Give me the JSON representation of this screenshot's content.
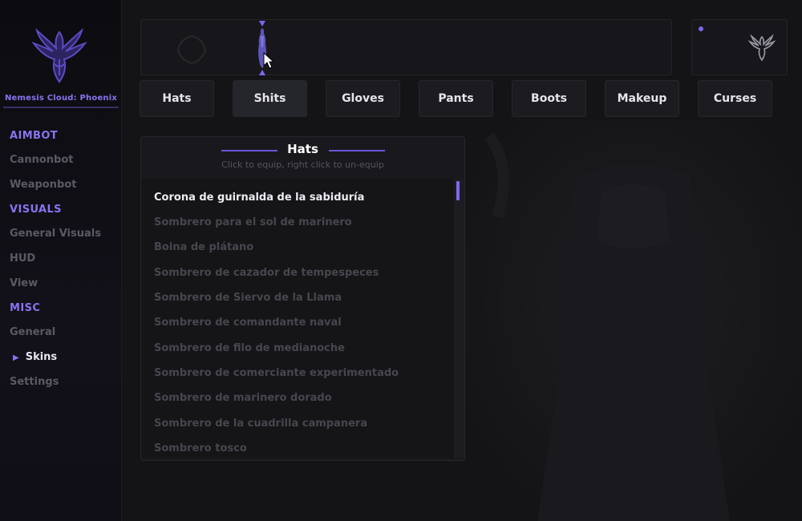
{
  "brand": {
    "name": "Nemesis Cloud: Phoenix",
    "logo_icon": "phoenix-icon"
  },
  "accent": "#7b68ee",
  "sidebar": {
    "sections": [
      {
        "category": "AIMBOT",
        "items": [
          "Cannonbot",
          "Weaponbot"
        ]
      },
      {
        "category": "VISUALS",
        "items": [
          "General Visuals",
          "HUD",
          "View"
        ]
      },
      {
        "category": "MISC",
        "items": [
          "General",
          "Skins",
          "Settings"
        ]
      }
    ],
    "active": "Skins"
  },
  "tabs": [
    "Hats",
    "Shits",
    "Gloves",
    "Pants",
    "Boots",
    "Makeup",
    "Curses"
  ],
  "active_tab": "Shits",
  "panel": {
    "title": "Hats",
    "subtitle": "Click to equip, right click to un-equip",
    "equipped_index": 0,
    "items": [
      "Corona de guirnalda de la sabiduría",
      "Sombrero para el sol de marinero",
      "Boina de plátano",
      "Sombrero de cazador de tempespeces",
      "Sombrero de Siervo de la Llama",
      "Sombrero de comandante naval",
      "Sombrero de filo de medianoche",
      "Sombrero de comerciante experimentado",
      "Sombrero de marinero dorado",
      "Sombrero de la cuadrilla campanera",
      "Sombrero tosco"
    ]
  }
}
